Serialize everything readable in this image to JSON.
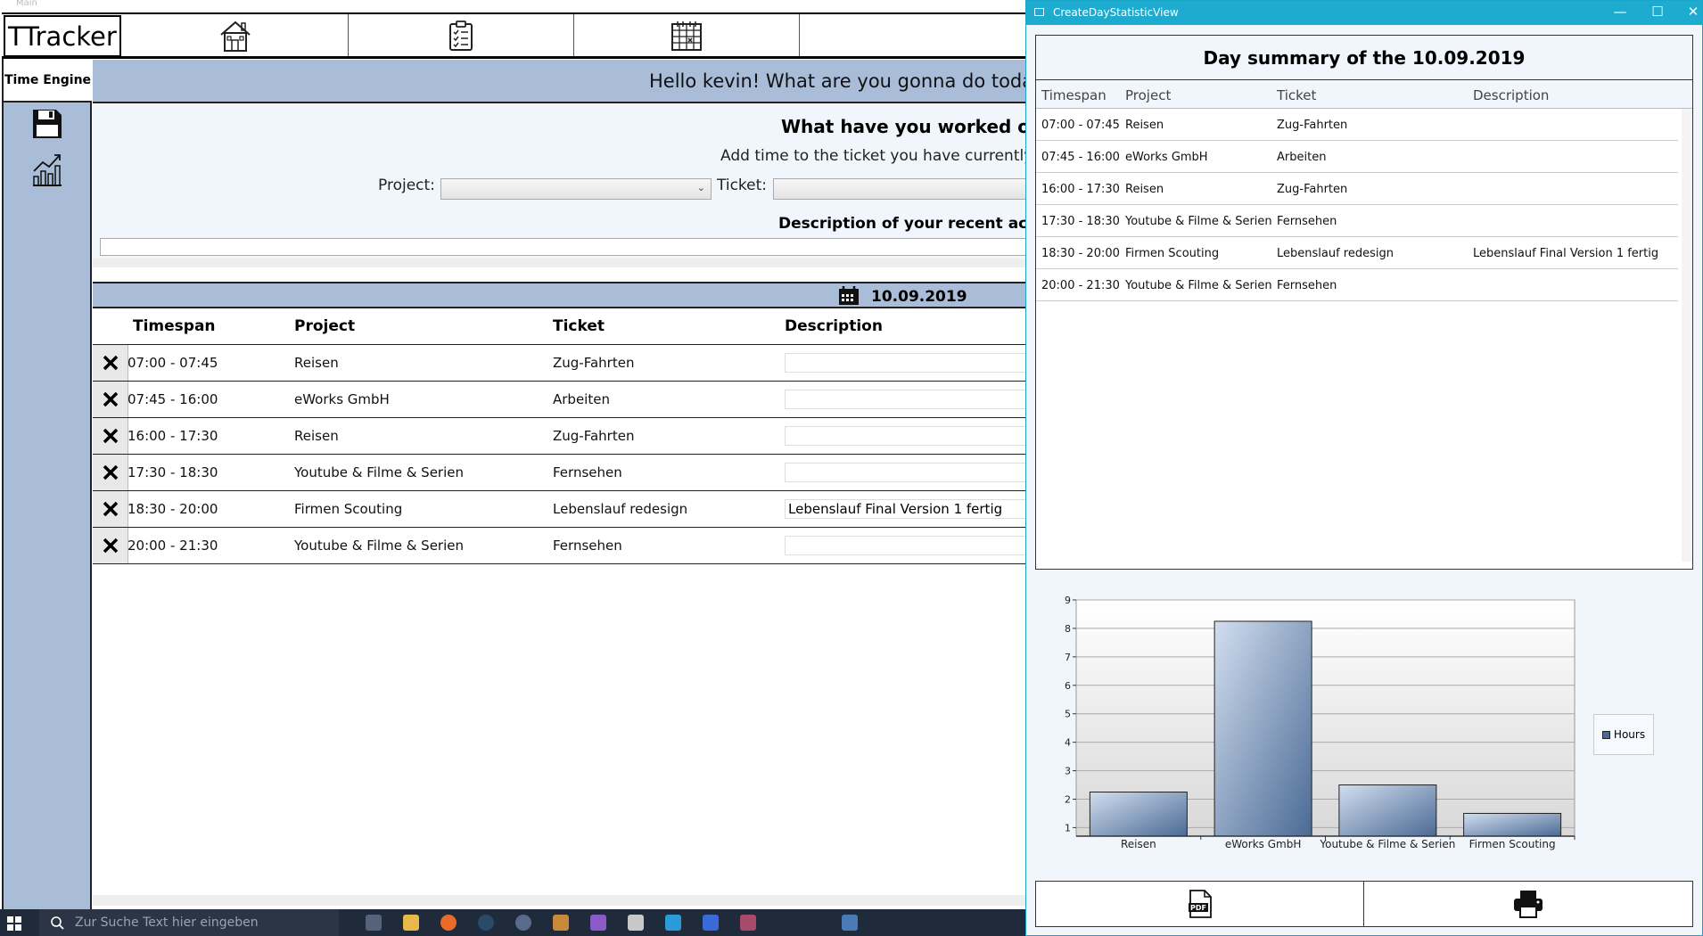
{
  "main": {
    "window_title": "Main",
    "logo": "TTracker",
    "sidebar": {
      "tab_label": "Time Engine"
    },
    "banner_text": "Hello kevin! What are you gonna do today, on",
    "form": {
      "title": "What have you worked on?",
      "subtitle": "Add time to the ticket you have currently worl",
      "project_label": "Project:",
      "ticket_label": "Ticket:",
      "description_label": "Description of your recent activity:"
    },
    "date": "10.09.2019",
    "table": {
      "headers": [
        "Timespan",
        "Project",
        "Ticket",
        "Description"
      ],
      "rows": [
        {
          "timespan": "07:00  -  07:45",
          "project": "Reisen",
          "ticket": "Zug-Fahrten",
          "description": ""
        },
        {
          "timespan": "07:45  -  16:00",
          "project": "eWorks GmbH",
          "ticket": "Arbeiten",
          "description": ""
        },
        {
          "timespan": "16:00  -  17:30",
          "project": "Reisen",
          "ticket": "Zug-Fahrten",
          "description": ""
        },
        {
          "timespan": "17:30  -  18:30",
          "project": "Youtube & Filme & Serien",
          "ticket": "Fernsehen",
          "description": ""
        },
        {
          "timespan": "18:30  -  20:00",
          "project": "Firmen Scouting",
          "ticket": "Lebenslauf redesign",
          "description": "Lebenslauf Final Version 1 fertig"
        },
        {
          "timespan": "20:00  -  21:30",
          "project": "Youtube & Filme & Serien",
          "ticket": "Fernsehen",
          "description": ""
        }
      ]
    }
  },
  "stat": {
    "window_title": "CreateDayStatisticView",
    "summary_title": "Day summary of the 10.09.2019",
    "headers": [
      "Timespan",
      "Project",
      "Ticket",
      "Description"
    ],
    "rows": [
      {
        "timespan": "07:00 - 07:45",
        "project": "Reisen",
        "ticket": "Zug-Fahrten",
        "description": ""
      },
      {
        "timespan": "07:45 - 16:00",
        "project": "eWorks GmbH",
        "ticket": "Arbeiten",
        "description": ""
      },
      {
        "timespan": "16:00 - 17:30",
        "project": "Reisen",
        "ticket": "Zug-Fahrten",
        "description": ""
      },
      {
        "timespan": "17:30 - 18:30",
        "project": "Youtube & Filme & Serien",
        "ticket": "Fernsehen",
        "description": ""
      },
      {
        "timespan": "18:30 - 20:00",
        "project": "Firmen Scouting",
        "ticket": "Lebenslauf redesign",
        "description": "Lebenslauf Final Version 1 fertig"
      },
      {
        "timespan": "20:00 - 21:30",
        "project": "Youtube & Filme & Serien",
        "ticket": "Fernsehen",
        "description": ""
      }
    ]
  },
  "chart_data": {
    "type": "bar",
    "categories": [
      "Reisen",
      "eWorks GmbH",
      "Youtube & Filme & Serien",
      "Firmen Scouting"
    ],
    "series": [
      {
        "name": "Hours",
        "values": [
          2.25,
          8.25,
          2.5,
          1.5
        ]
      }
    ],
    "yticks": [
      1,
      2,
      3,
      4,
      5,
      6,
      7,
      8,
      9
    ],
    "ylim": [
      0.7,
      9
    ],
    "grid": true,
    "legend": "right"
  },
  "taskbar": {
    "search_placeholder": "Zur Suche Text hier eingeben"
  },
  "colors": {
    "accent": "#a9bcd8",
    "titlebar": "#1dabcf",
    "bar": "#4a6a95"
  }
}
